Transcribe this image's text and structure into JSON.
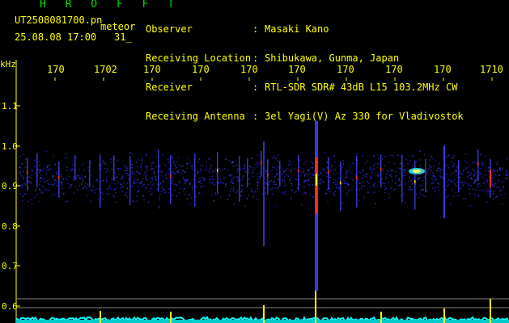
{
  "header": {
    "station": "H R O F F T",
    "filename": "UT2508081700.pn",
    "meteor_label": "meteor",
    "datetime": "25.08.08 17:00",
    "count": "31_"
  },
  "info": {
    "labels": [
      "Observer",
      "Receiving Location",
      "Receiver",
      "Receiving Antenna"
    ],
    "separator": ":",
    "values": [
      "Masaki Kano",
      "Shibukawa, Gunma, Japan",
      "RTL-SDR SDR# 43dB L15 103.2MHz CW",
      "3el Yagi(V) Az 330 for Vladivostok"
    ]
  },
  "axes": {
    "y_unit": "kHz",
    "x_ticks": [
      "170̣",
      "1702",
      "170̣",
      "170̣",
      "170̣",
      "170̣",
      "170̣",
      "170̣",
      "170̣",
      "1710"
    ],
    "x_ticks_display": [
      "170",
      "1702",
      "170",
      "170",
      "170",
      "170",
      "170",
      "170",
      "170",
      "1710"
    ],
    "y_ticks": [
      "1.1",
      "1.0",
      "0.9",
      "0.8",
      "0.7",
      "0.6"
    ]
  },
  "colors": {
    "header_green": "#00dd00",
    "text_yellow": "#ffff00",
    "background": "#000000",
    "signal_band": "#1a1aa0",
    "meteor_trace": "#ff3030",
    "bottom_trace": "#00ffff"
  }
}
